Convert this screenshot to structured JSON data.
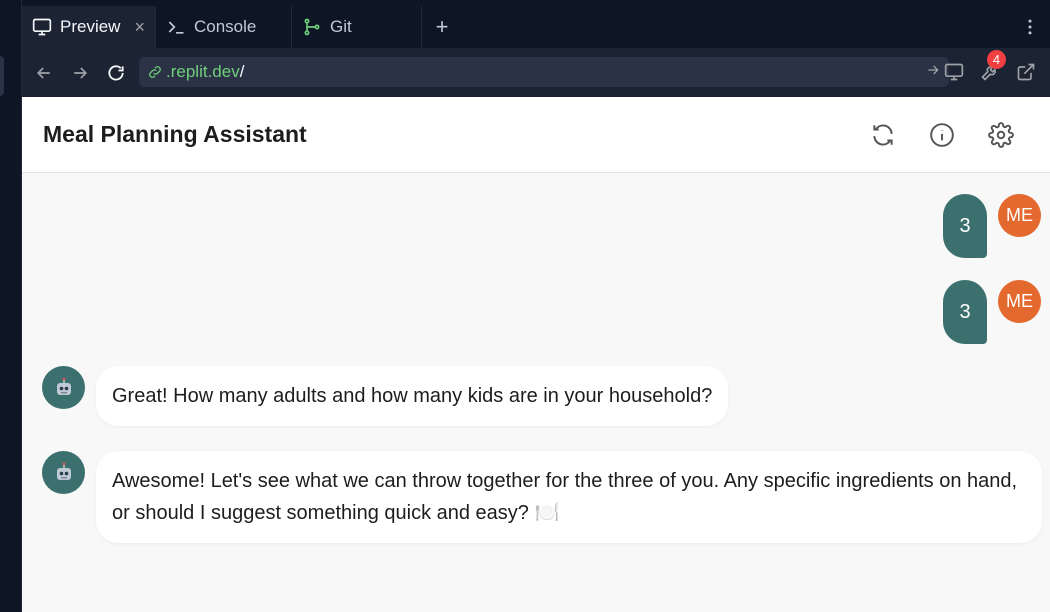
{
  "tabs": [
    {
      "label": "Preview",
      "icon": "monitor-icon",
      "active": true
    },
    {
      "label": "Console",
      "icon": "terminal-icon"
    },
    {
      "label": "Git",
      "icon": "git-icon"
    }
  ],
  "urlbar": {
    "domain": ".replit.dev",
    "path": "/",
    "notification_count": "4"
  },
  "app": {
    "title": "Meal Planning Assistant"
  },
  "messages": [
    {
      "role": "user",
      "avatar": "ME",
      "text": "3"
    },
    {
      "role": "user",
      "avatar": "ME",
      "text": "3"
    },
    {
      "role": "assistant",
      "avatar_icon": "robot-icon",
      "text": "Great! How many adults and how many kids are in your household?"
    },
    {
      "role": "assistant",
      "avatar_icon": "robot-icon",
      "text": "Awesome! Let's see what we can throw together for the three of you. Any specific ingredients on hand, or should I suggest something quick and easy? 🍽️"
    }
  ],
  "colors": {
    "accent": "#3b706e",
    "user_avatar": "#e4692e",
    "badge": "#f23f42",
    "link_green": "#6fcf7a"
  }
}
